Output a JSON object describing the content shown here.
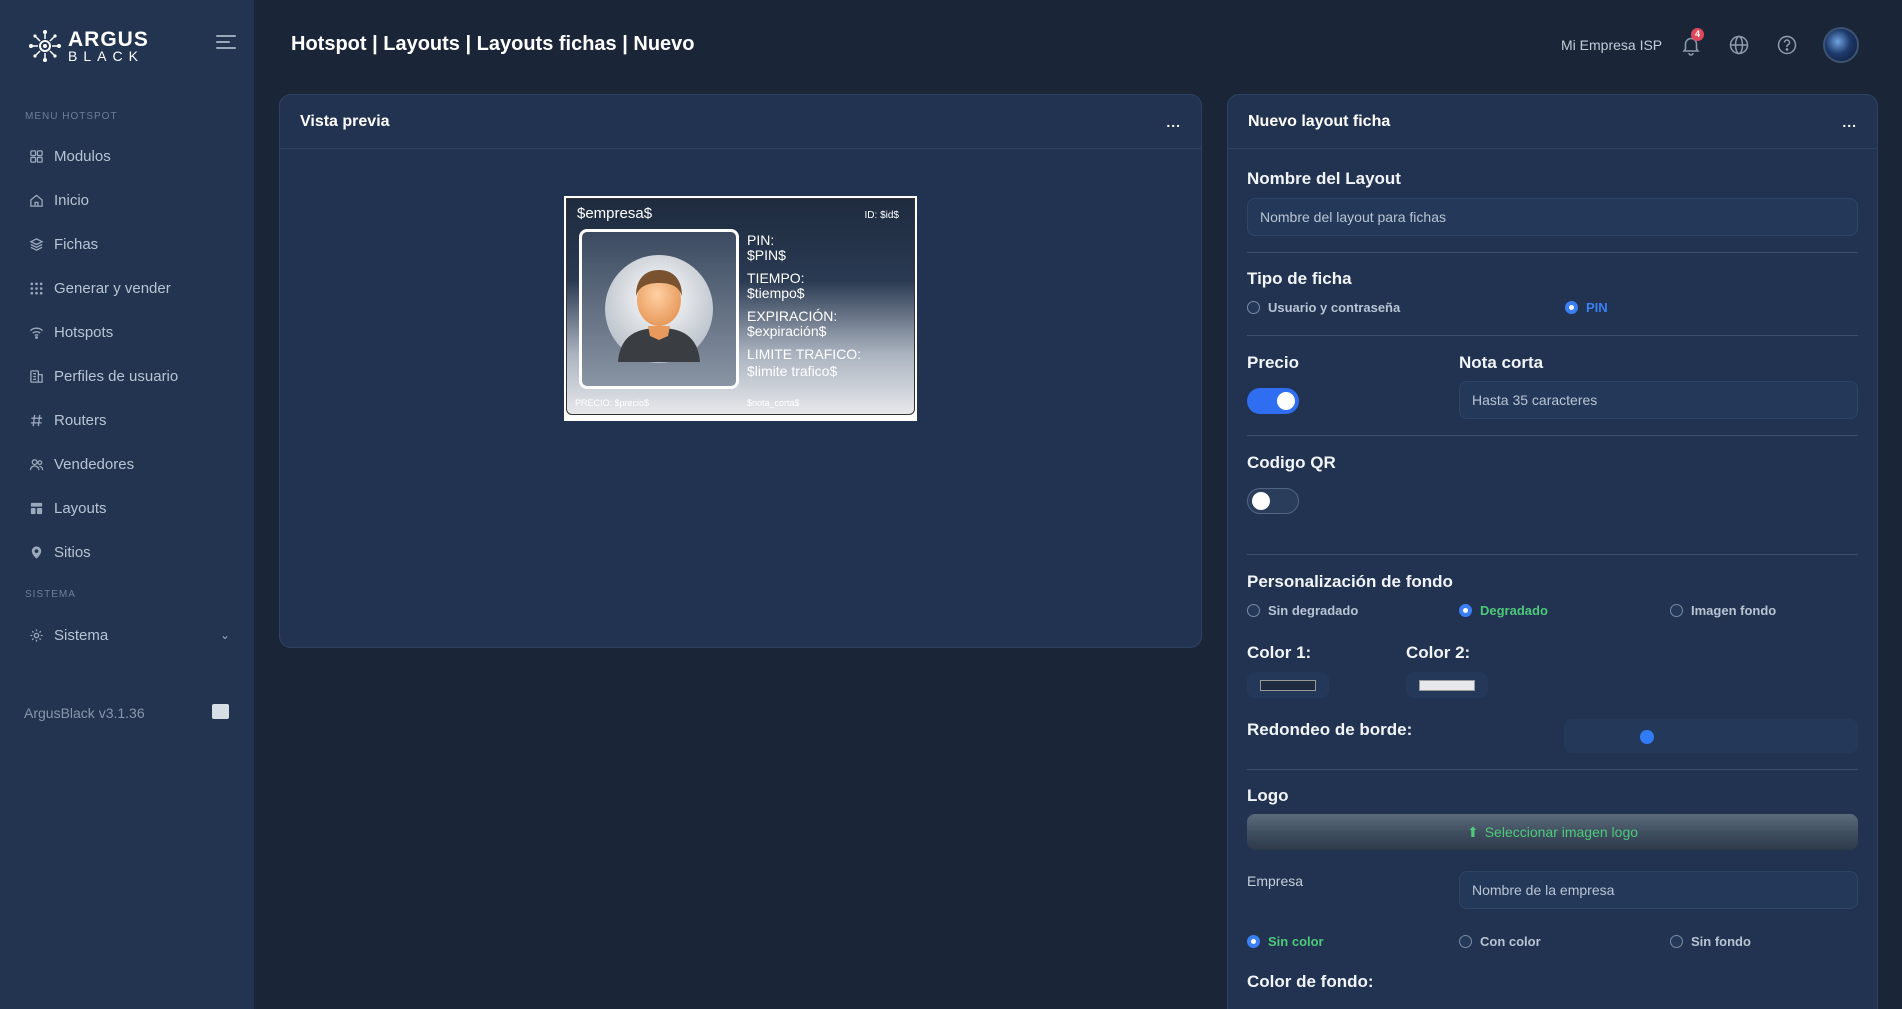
{
  "brand": {
    "name_line1": "ARGUS",
    "name_line2": "BLACK"
  },
  "sidebar": {
    "section_hotspot": "MENU HOTSPOT",
    "section_system": "SISTEMA",
    "items": [
      {
        "label": "Modulos",
        "icon": "grid-icon"
      },
      {
        "label": "Inicio",
        "icon": "home-icon"
      },
      {
        "label": "Fichas",
        "icon": "layers-icon"
      },
      {
        "label": "Generar y vender",
        "icon": "apps-icon"
      },
      {
        "label": "Hotspots",
        "icon": "wifi-icon"
      },
      {
        "label": "Perfiles de usuario",
        "icon": "profile-icon"
      },
      {
        "label": "Routers",
        "icon": "hash-icon"
      },
      {
        "label": "Vendedores",
        "icon": "users-icon"
      },
      {
        "label": "Layouts",
        "icon": "layout-icon"
      },
      {
        "label": "Sitios",
        "icon": "pin-icon"
      }
    ],
    "system_item": {
      "label": "Sistema",
      "icon": "gear-icon"
    },
    "version": "ArgusBlack v3.1.36"
  },
  "header": {
    "title": "Hotspot | Layouts | Layouts fichas | Nuevo",
    "company": "Mi Empresa ISP",
    "notification_count": "4"
  },
  "preview": {
    "title": "Vista previa",
    "menu": "...",
    "ticket": {
      "empresa": "$empresa$",
      "id": "ID: $id$",
      "lines": [
        "PIN:",
        "$PIN$",
        "TIEMPO:",
        "$tiempo$",
        "EXPIRACIÓN:",
        "$expiración$",
        "LIMITE TRAFICO:",
        "$limite trafico$"
      ],
      "precio": "PRECIO: $precio$",
      "nota": "$nota_corta$"
    }
  },
  "form": {
    "title": "Nuevo layout ficha",
    "menu": "...",
    "nombre_label": "Nombre del Layout",
    "nombre_placeholder": "Nombre del layout para fichas",
    "tipo_label": "Tipo de ficha",
    "tipo_options": [
      "Usuario y contraseña",
      "PIN"
    ],
    "tipo_selected": "PIN",
    "precio_label": "Precio",
    "precio_on": true,
    "nota_label": "Nota corta",
    "nota_placeholder": "Hasta 35 caracteres",
    "qr_label": "Codigo QR",
    "qr_on": false,
    "fondo_label": "Personalización de fondo",
    "fondo_options": [
      "Sin degradado",
      "Degradado",
      "Imagen fondo"
    ],
    "fondo_selected": "Degradado",
    "color1_label": "Color 1:",
    "color1": "#1e2b3f",
    "color2_label": "Color 2:",
    "color2": "#e6e8eb",
    "borde_label": "Redondeo de borde:",
    "borde_value": 0.27,
    "logo_label": "Logo",
    "logo_button": "Seleccionar imagen logo",
    "empresa_label": "Empresa",
    "empresa_placeholder": "Nombre de la empresa",
    "empresa_options": [
      "Sin color",
      "Con color",
      "Sin fondo"
    ],
    "empresa_selected": "Sin color",
    "color_fondo_label": "Color de fondo:"
  },
  "colors": {
    "accent": "#2f6ef0",
    "selected_text": "#4ec97a",
    "badge": "#e0485b"
  }
}
